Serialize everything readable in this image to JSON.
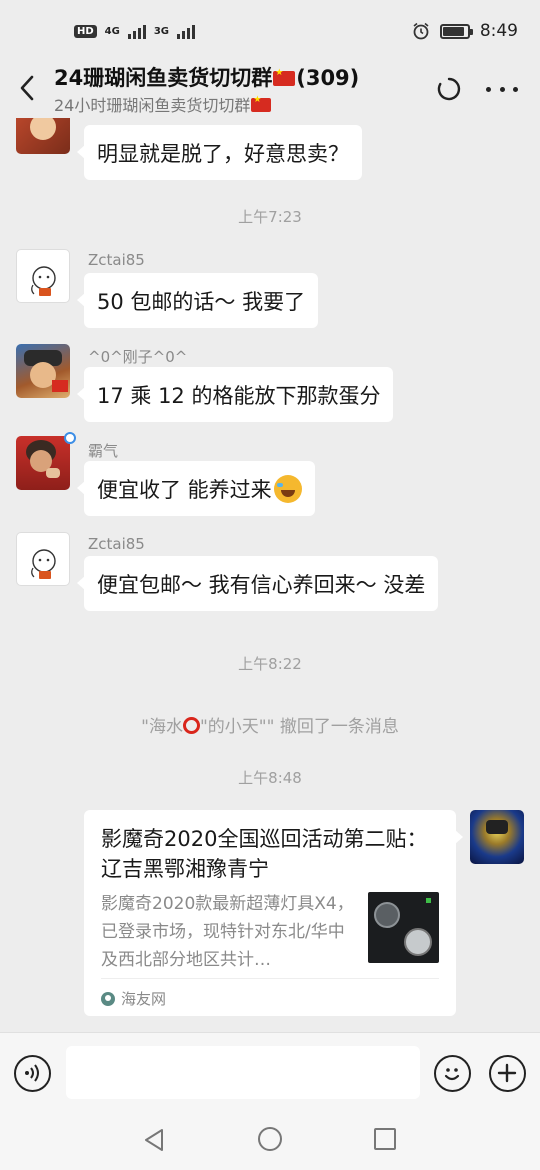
{
  "status_bar": {
    "network_badge": "HD",
    "network_1": "4G",
    "network_2": "3G",
    "time": "8:49"
  },
  "header": {
    "title": "24珊瑚闲鱼卖货切切群",
    "member_count": "(309)",
    "subtitle": "24小时珊瑚闲鱼卖货切切群"
  },
  "messages": [
    {
      "type": "text",
      "sender": "",
      "text": "明显就是脱了，好意思卖？"
    },
    {
      "type": "time",
      "text": "上午7:23"
    },
    {
      "type": "text",
      "sender": "Zctai85",
      "text": "50 包邮的话～ 我要了"
    },
    {
      "type": "text",
      "sender": "^0^刚子^0^",
      "text": "17 乘 12 的格能放下那款蛋分"
    },
    {
      "type": "text",
      "sender": "霸气",
      "text": "便宜收了 能养过来"
    },
    {
      "type": "text",
      "sender": "Zctai85",
      "text": "便宜包邮～ 我有信心养回来～ 没差"
    },
    {
      "type": "time",
      "text": "上午8:22"
    },
    {
      "type": "system",
      "text_prefix": "\"海水",
      "text_suffix": "\"的小天\"\" 撤回了一条消息"
    },
    {
      "type": "time",
      "text": "上午8:48"
    }
  ],
  "card": {
    "title": "影魔奇2020全国巡回活动第二贴： 辽吉黑鄂湘豫青宁",
    "description": "影魔奇2020款最新超薄灯具X4，已登录市场，现特针对东北/华中及西北部分地区共计…",
    "source": "海友网"
  },
  "input": {
    "placeholder": ""
  },
  "colors": {
    "background": "#ededed",
    "bubble": "#ffffff",
    "flag_red": "#d62b20"
  }
}
